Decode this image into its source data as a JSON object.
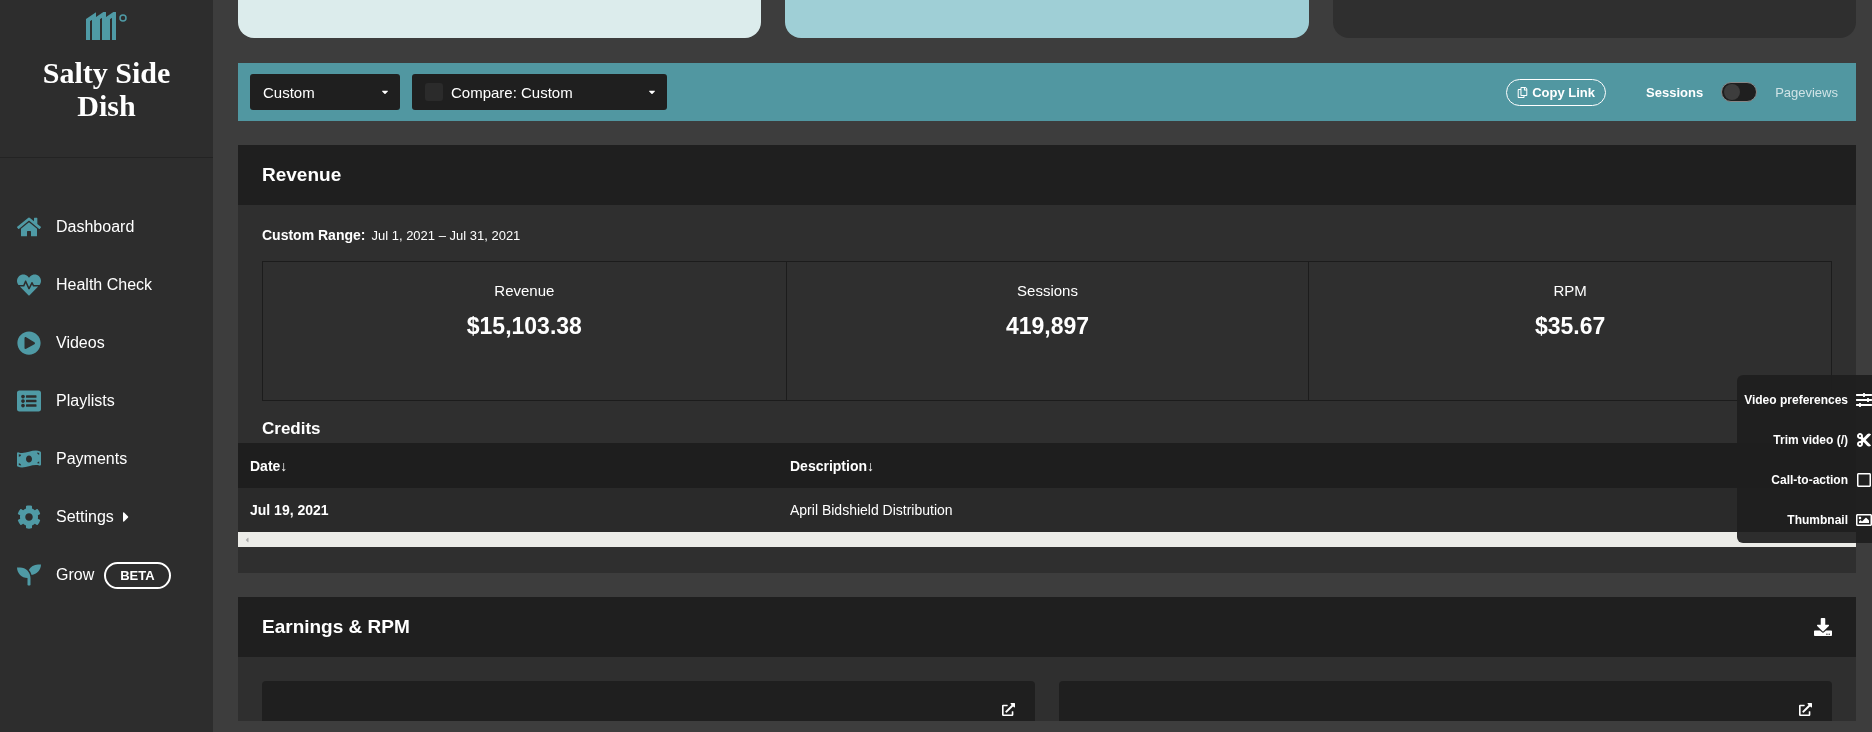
{
  "sidebar": {
    "brand": "Salty Side Dish",
    "items": [
      {
        "label": "Dashboard",
        "kind": "home"
      },
      {
        "label": "Health Check",
        "kind": "heart"
      },
      {
        "label": "Videos",
        "kind": "play"
      },
      {
        "label": "Playlists",
        "kind": "list"
      },
      {
        "label": "Payments",
        "kind": "bag"
      },
      {
        "label": "Settings",
        "kind": "gear",
        "submenu": true
      },
      {
        "label": "Grow",
        "kind": "lotus",
        "badge": "BETA"
      }
    ]
  },
  "filters": {
    "range": "Custom",
    "compare": "Compare: Custom",
    "copy_link": "Copy Link",
    "metric_toggle": [
      {
        "label": "Sessions",
        "selected": true
      },
      {
        "label": "Pageviews",
        "selected": false
      }
    ]
  },
  "revenue": {
    "title": "Revenue",
    "range_label": "Custom Range:",
    "range_value": "Jul 1, 2021 – Jul 31, 2021",
    "stats": [
      {
        "label": "Revenue",
        "value": "$15,103.38"
      },
      {
        "label": "Sessions",
        "value": "419,897"
      },
      {
        "label": "RPM",
        "value": "$35.67"
      }
    ],
    "credits": {
      "title": "Credits",
      "columns": [
        "Date↓",
        "Description↓"
      ],
      "rows": [
        [
          "Jul 19, 2021",
          "April Bidshield Distribution"
        ]
      ]
    }
  },
  "video_menu": [
    {
      "label": "Video preferences",
      "kind": "sliders"
    },
    {
      "label": "Trim video (/)",
      "kind": "scissors"
    },
    {
      "label": "Call-to-action",
      "kind": "cta"
    },
    {
      "label": "Thumbnail",
      "kind": "image"
    }
  ],
  "earnings": {
    "title": "Earnings & RPM"
  }
}
